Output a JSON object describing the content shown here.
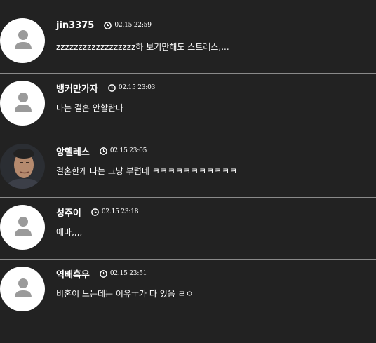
{
  "comments": [
    {
      "nick": "jin3375",
      "time": "02.15 22:59",
      "text": "zzzzzzzzzzzzzzzzzz하 보기만해도 스트레스,..."
    },
    {
      "nick": "뱅커만가자",
      "time": "02.15 23:03",
      "text": "나는 결혼 안할란다"
    },
    {
      "nick": "앙헬레스",
      "time": "02.15 23:05",
      "text": "결혼한게 나는 그냥 부럽네 ㅋㅋㅋㅋㅋㅋㅋㅋㅋㅋㅋ"
    },
    {
      "nick": "성주이",
      "time": "02.15 23:18",
      "text": "에바,,,,"
    },
    {
      "nick": "역배흑우",
      "time": "02.15 23:51",
      "text": "비혼이 느는데는 이유ㅜ가 다 있음 ㄹㅇ"
    }
  ],
  "colors": {
    "background": "#222222",
    "divider": "#8a8a8a",
    "avatar_bg": "#ffffff",
    "avatar_icon": "#9a9a9a"
  }
}
